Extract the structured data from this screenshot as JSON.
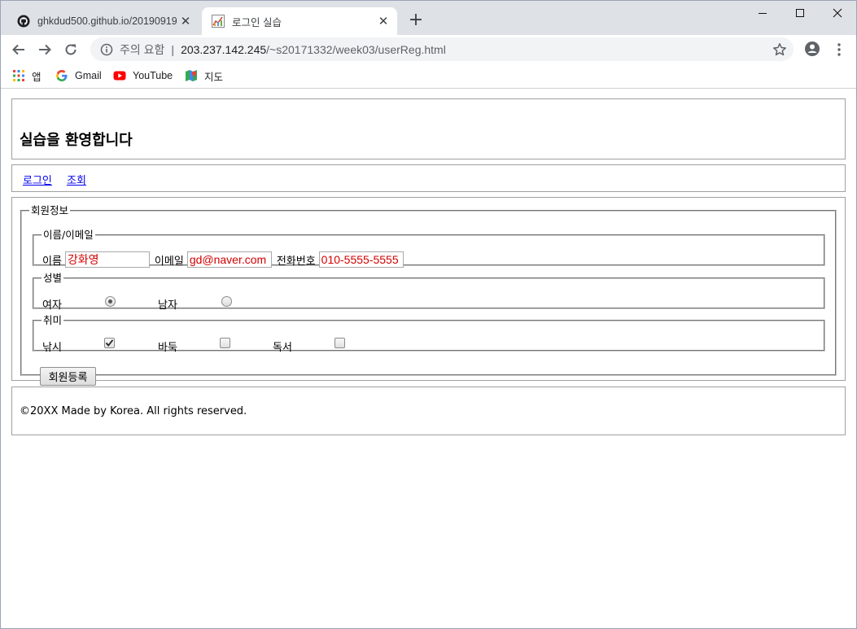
{
  "browser": {
    "tabs": [
      {
        "title": "ghkdud500.github.io/20190919",
        "active": false
      },
      {
        "title": "로그인 실습",
        "active": true
      }
    ],
    "address": {
      "security_label": "주의 요함",
      "host": "203.237.142.245",
      "path": "/~s20171332/week03/userReg.html"
    },
    "bookmarks": [
      {
        "label": "앱",
        "icon": "apps-grid-icon"
      },
      {
        "label": "Gmail",
        "icon": "google-g-icon"
      },
      {
        "label": "YouTube",
        "icon": "youtube-icon"
      },
      {
        "label": "지도",
        "icon": "maps-icon"
      }
    ]
  },
  "page": {
    "header": {
      "title": "실습을 환영합니다"
    },
    "nav": {
      "items": [
        "로그인",
        "조회"
      ]
    },
    "form": {
      "legend": "회원정보",
      "name_email": {
        "legend": "이름/이메일",
        "name_label": "이름",
        "name_value": "강화영",
        "email_label": "이메일",
        "email_value": "gd@naver.com",
        "phone_label": "전화번호",
        "phone_value": "010-5555-5555"
      },
      "gender": {
        "legend": "성별",
        "options": [
          {
            "label": "여자",
            "checked": true
          },
          {
            "label": "남자",
            "checked": false
          }
        ]
      },
      "hobby": {
        "legend": "취미",
        "options": [
          {
            "label": "낚시",
            "checked": true
          },
          {
            "label": "바둑",
            "checked": false
          },
          {
            "label": "독서",
            "checked": false
          }
        ]
      },
      "submit_label": "회원등록"
    },
    "footer": {
      "text": "©20XX Made by Korea. All rights reserved."
    }
  },
  "colors": {
    "input_text": "#d40000",
    "link": "#0000ee",
    "tabstrip": "#dee1e6"
  }
}
